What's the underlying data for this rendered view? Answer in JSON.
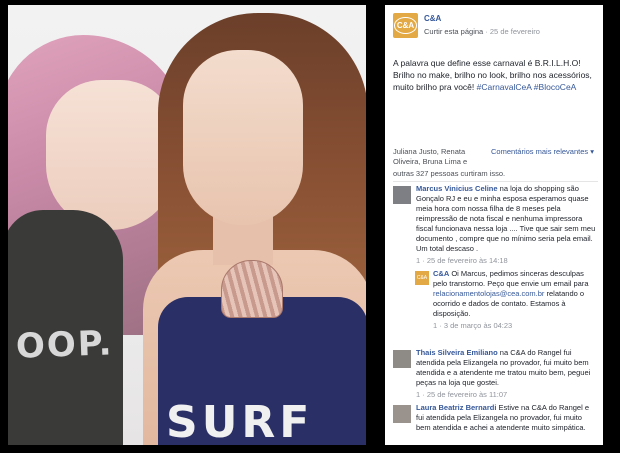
{
  "photo": {
    "left_shirt_text": "OOP.",
    "right_top_text": "SURF"
  },
  "page": {
    "logo_text": "C&A",
    "name": "C&A",
    "like_label": "Curtir esta página",
    "separator": "·",
    "date": "25 de fevereiro",
    "brand_color": "#365899"
  },
  "post": {
    "text": "A palavra que define esse carnaval é B.R.I.L.H.O! Brilho no make, brilho no look, brilho nos acessórios, muito brilho pra você!",
    "hashtags": "#CarnavalCeA #BlocoCeA"
  },
  "reactions": {
    "names_prefix": "Juliana Justo, Renata Oliveira, Bruna Lima e",
    "count_text": "outras 327 pessoas curtiram isso.",
    "comments_sort": "Comentários mais relevantes ▾"
  },
  "comments": [
    {
      "author": "Marcus Vinicius Celine",
      "text": "na loja do shopping são Gonçalo RJ e eu e minha esposa esperamos quase meia hora com nossa filha de 8 meses pela reimpressão de nota fiscal e nenhuma impressora fiscal funcionava nessa loja .... Tive que sair sem meu documento , compre que no mínimo seria pela email. Um total descaso .",
      "meta": "1 · 25 de fevereiro às 14:18"
    },
    {
      "author": "C&A",
      "text": "Oi Marcus, pedimos sinceras desculpas pelo transtorno. Peço que envie um email para",
      "email": "relacionamentolojas@cea.com.br",
      "text2": "relatando o ocorrido e dados de contato. Estamos à disposição.",
      "meta": "1 · 3 de março às 04:23"
    },
    {
      "author": "Thais Silveira Emiliano",
      "text": "na C&A do Rangel fui atendida pela Elizangela no provador, fui muito bem atendida e a atendente me tratou muito bem, peguei peças na loja que gostei.",
      "meta": "1 · 25 de fevereiro às 11:07"
    },
    {
      "author": "Laura Beatriz Bernardi",
      "text": "Estive na C&A do Rangel e fui atendida pela Elizangela no provador, fui muito bem atendida e achei a atendente muito simpática.",
      "meta": ""
    }
  ]
}
